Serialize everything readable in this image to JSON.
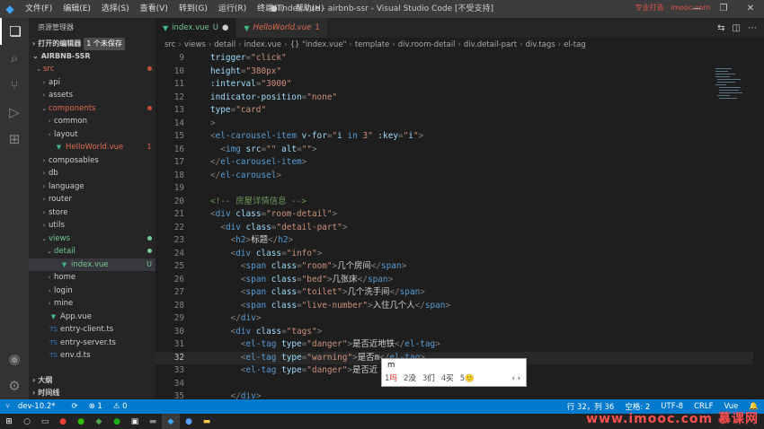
{
  "menu": [
    "文件(F)",
    "编辑(E)",
    "选择(S)",
    "查看(V)",
    "转到(G)",
    "运行(R)",
    "终端(T)",
    "帮助(H)"
  ],
  "window_title": "● index.vue - airbnb-ssr - Visual Studio Code [不受支持]",
  "watermark_top": "专业打造 · imooc.com",
  "sidebar": {
    "title": "资源管理器",
    "open_editors": "打开的编辑器",
    "unsaved_badge": "1 个未保存",
    "project": "AIRBNB-SSR",
    "items": [
      {
        "name": "src",
        "indent": 1,
        "chev": "⌄",
        "color": "#e06c4f",
        "status": "dot-red",
        "sel": false
      },
      {
        "name": "api",
        "indent": 2,
        "chev": "›",
        "color": "#ccc",
        "status": "",
        "sel": false
      },
      {
        "name": "assets",
        "indent": 2,
        "chev": "›",
        "color": "#ccc",
        "status": "",
        "sel": false
      },
      {
        "name": "components",
        "indent": 2,
        "chev": "⌄",
        "color": "#e06c4f",
        "status": "dot-red",
        "sel": false
      },
      {
        "name": "common",
        "indent": 3,
        "chev": "›",
        "color": "#ccc",
        "status": "",
        "sel": false
      },
      {
        "name": "layout",
        "indent": 3,
        "chev": "›",
        "color": "#ccc",
        "status": "",
        "sel": false
      },
      {
        "name": "HelloWorld.vue",
        "indent": 3,
        "chev": "",
        "color": "#e06c4f",
        "status": "1",
        "sel": false,
        "icon": "vue"
      },
      {
        "name": "composables",
        "indent": 2,
        "chev": "›",
        "color": "#ccc",
        "status": "",
        "sel": false
      },
      {
        "name": "db",
        "indent": 2,
        "chev": "›",
        "color": "#ccc",
        "status": "",
        "sel": false
      },
      {
        "name": "language",
        "indent": 2,
        "chev": "›",
        "color": "#ccc",
        "status": "",
        "sel": false
      },
      {
        "name": "router",
        "indent": 2,
        "chev": "›",
        "color": "#ccc",
        "status": "",
        "sel": false
      },
      {
        "name": "store",
        "indent": 2,
        "chev": "›",
        "color": "#ccc",
        "status": "",
        "sel": false
      },
      {
        "name": "utils",
        "indent": 2,
        "chev": "›",
        "color": "#ccc",
        "status": "",
        "sel": false
      },
      {
        "name": "views",
        "indent": 2,
        "chev": "⌄",
        "color": "#73c991",
        "status": "dot-green",
        "sel": false
      },
      {
        "name": "detail",
        "indent": 3,
        "chev": "⌄",
        "color": "#73c991",
        "status": "dot-green",
        "sel": false
      },
      {
        "name": "index.vue",
        "indent": 4,
        "chev": "",
        "color": "#73c991",
        "status": "U",
        "sel": true,
        "icon": "vue"
      },
      {
        "name": "home",
        "indent": 3,
        "chev": "›",
        "color": "#ccc",
        "status": "",
        "sel": false
      },
      {
        "name": "login",
        "indent": 3,
        "chev": "›",
        "color": "#ccc",
        "status": "",
        "sel": false
      },
      {
        "name": "mine",
        "indent": 3,
        "chev": "›",
        "color": "#ccc",
        "status": "",
        "sel": false
      },
      {
        "name": "App.vue",
        "indent": 2,
        "chev": "",
        "color": "#ccc",
        "status": "",
        "sel": false,
        "icon": "vue"
      },
      {
        "name": "entry-client.ts",
        "indent": 2,
        "chev": "",
        "color": "#ccc",
        "status": "",
        "sel": false,
        "icon": "ts"
      },
      {
        "name": "entry-server.ts",
        "indent": 2,
        "chev": "",
        "color": "#ccc",
        "status": "",
        "sel": false,
        "icon": "ts"
      },
      {
        "name": "env.d.ts",
        "indent": 2,
        "chev": "",
        "color": "#ccc",
        "status": "",
        "sel": false,
        "icon": "ts"
      }
    ],
    "outline": "大纲",
    "timeline": "时间线"
  },
  "tabs": [
    {
      "label": "index.vue",
      "suffix": "U",
      "active": true,
      "modified": true
    },
    {
      "label": "HelloWorld.vue",
      "suffix": "1",
      "active": false,
      "modified": false
    }
  ],
  "breadcrumbs": [
    "src",
    "views",
    "detail",
    "index.vue",
    "{} \"index.vue\"",
    "template",
    "div.room-detail",
    "div.detail-part",
    "div.tags",
    "el-tag"
  ],
  "code_lines": [
    {
      "n": "9",
      "t": [
        [
          "t-attr",
          "trigger"
        ],
        [
          "t-pun",
          "="
        ],
        [
          "t-str",
          "\"click\""
        ]
      ]
    },
    {
      "n": "10",
      "t": [
        [
          "t-attr",
          "height"
        ],
        [
          "t-pun",
          "="
        ],
        [
          "t-str",
          "\"380px\""
        ]
      ]
    },
    {
      "n": "11",
      "t": [
        [
          "t-attr",
          ":interval"
        ],
        [
          "t-pun",
          "="
        ],
        [
          "t-str",
          "\"3000\""
        ]
      ]
    },
    {
      "n": "12",
      "t": [
        [
          "t-attr",
          "indicator-position"
        ],
        [
          "t-pun",
          "="
        ],
        [
          "t-str",
          "\"none\""
        ]
      ]
    },
    {
      "n": "13",
      "t": [
        [
          "t-attr",
          "type"
        ],
        [
          "t-pun",
          "="
        ],
        [
          "t-str",
          "\"card\""
        ]
      ]
    },
    {
      "n": "14",
      "t": [
        [
          "t-pun",
          ">"
        ]
      ]
    },
    {
      "n": "15",
      "t": [
        [
          "t-pun",
          "<"
        ],
        [
          "t-tag",
          "el-carousel-item"
        ],
        [
          "t-txt",
          " "
        ],
        [
          "t-attr",
          "v-for"
        ],
        [
          "t-pun",
          "="
        ],
        [
          "t-str",
          "\""
        ],
        [
          "t-attr",
          "i"
        ],
        [
          "t-txt",
          " "
        ],
        [
          "t-tag",
          "in"
        ],
        [
          "t-txt",
          " "
        ],
        [
          "t-str",
          "3"
        ],
        [
          "t-str",
          "\""
        ],
        [
          "t-txt",
          " "
        ],
        [
          "t-attr",
          ":key"
        ],
        [
          "t-pun",
          "="
        ],
        [
          "t-str",
          "\""
        ],
        [
          "t-attr",
          "i"
        ],
        [
          "t-str",
          "\""
        ],
        [
          "t-pun",
          ">"
        ]
      ]
    },
    {
      "n": "16",
      "t": [
        [
          "t-txt",
          "  "
        ],
        [
          "t-pun",
          "<"
        ],
        [
          "t-tag",
          "img"
        ],
        [
          "t-txt",
          " "
        ],
        [
          "t-attr",
          "src"
        ],
        [
          "t-pun",
          "="
        ],
        [
          "t-str",
          "\"\""
        ],
        [
          "t-txt",
          " "
        ],
        [
          "t-attr",
          "alt"
        ],
        [
          "t-pun",
          "="
        ],
        [
          "t-str",
          "\"\""
        ],
        [
          "t-pun",
          ">"
        ]
      ]
    },
    {
      "n": "17",
      "t": [
        [
          "t-pun",
          "</"
        ],
        [
          "t-tag",
          "el-carousel-item"
        ],
        [
          "t-pun",
          ">"
        ]
      ]
    },
    {
      "n": "18",
      "t": [
        [
          "t-pun",
          "</"
        ],
        [
          "t-tag",
          "el-carousel"
        ],
        [
          "t-pun",
          ">"
        ]
      ]
    },
    {
      "n": "19",
      "t": []
    },
    {
      "n": "20",
      "t": [
        [
          "t-com",
          "<!-- 房屋详情信息 -->"
        ]
      ]
    },
    {
      "n": "21",
      "t": [
        [
          "t-pun",
          "<"
        ],
        [
          "t-tag",
          "div"
        ],
        [
          "t-txt",
          " "
        ],
        [
          "t-attr",
          "class"
        ],
        [
          "t-pun",
          "="
        ],
        [
          "t-str",
          "\"room-detail\""
        ],
        [
          "t-pun",
          ">"
        ]
      ]
    },
    {
      "n": "22",
      "t": [
        [
          "t-txt",
          "  "
        ],
        [
          "t-pun",
          "<"
        ],
        [
          "t-tag",
          "div"
        ],
        [
          "t-txt",
          " "
        ],
        [
          "t-attr",
          "class"
        ],
        [
          "t-pun",
          "="
        ],
        [
          "t-str",
          "\"detail-part\""
        ],
        [
          "t-pun",
          ">"
        ]
      ]
    },
    {
      "n": "23",
      "t": [
        [
          "t-txt",
          "    "
        ],
        [
          "t-pun",
          "<"
        ],
        [
          "t-tag",
          "h2"
        ],
        [
          "t-pun",
          ">"
        ],
        [
          "t-txt",
          "标题"
        ],
        [
          "t-pun",
          "</"
        ],
        [
          "t-tag",
          "h2"
        ],
        [
          "t-pun",
          ">"
        ]
      ]
    },
    {
      "n": "24",
      "t": [
        [
          "t-txt",
          "    "
        ],
        [
          "t-pun",
          "<"
        ],
        [
          "t-tag",
          "div"
        ],
        [
          "t-txt",
          " "
        ],
        [
          "t-attr",
          "class"
        ],
        [
          "t-pun",
          "="
        ],
        [
          "t-str",
          "\"info\""
        ],
        [
          "t-pun",
          ">"
        ]
      ]
    },
    {
      "n": "25",
      "t": [
        [
          "t-txt",
          "      "
        ],
        [
          "t-pun",
          "<"
        ],
        [
          "t-tag",
          "span"
        ],
        [
          "t-txt",
          " "
        ],
        [
          "t-attr",
          "class"
        ],
        [
          "t-pun",
          "="
        ],
        [
          "t-str",
          "\"room\""
        ],
        [
          "t-pun",
          ">"
        ],
        [
          "t-txt",
          "几个房间"
        ],
        [
          "t-pun",
          "</"
        ],
        [
          "t-tag",
          "span"
        ],
        [
          "t-pun",
          ">"
        ]
      ]
    },
    {
      "n": "26",
      "t": [
        [
          "t-txt",
          "      "
        ],
        [
          "t-pun",
          "<"
        ],
        [
          "t-tag",
          "span"
        ],
        [
          "t-txt",
          " "
        ],
        [
          "t-attr",
          "class"
        ],
        [
          "t-pun",
          "="
        ],
        [
          "t-str",
          "\"bed\""
        ],
        [
          "t-pun",
          ">"
        ],
        [
          "t-txt",
          "几张床"
        ],
        [
          "t-pun",
          "</"
        ],
        [
          "t-tag",
          "span"
        ],
        [
          "t-pun",
          ">"
        ]
      ]
    },
    {
      "n": "27",
      "t": [
        [
          "t-txt",
          "      "
        ],
        [
          "t-pun",
          "<"
        ],
        [
          "t-tag",
          "span"
        ],
        [
          "t-txt",
          " "
        ],
        [
          "t-attr",
          "class"
        ],
        [
          "t-pun",
          "="
        ],
        [
          "t-str",
          "\"toilet\""
        ],
        [
          "t-pun",
          ">"
        ],
        [
          "t-txt",
          "几个洗手间"
        ],
        [
          "t-pun",
          "</"
        ],
        [
          "t-tag",
          "span"
        ],
        [
          "t-pun",
          ">"
        ]
      ]
    },
    {
      "n": "28",
      "t": [
        [
          "t-txt",
          "      "
        ],
        [
          "t-pun",
          "<"
        ],
        [
          "t-tag",
          "span"
        ],
        [
          "t-txt",
          " "
        ],
        [
          "t-attr",
          "class"
        ],
        [
          "t-pun",
          "="
        ],
        [
          "t-str",
          "\"live-number\""
        ],
        [
          "t-pun",
          ">"
        ],
        [
          "t-txt",
          "入住几个人"
        ],
        [
          "t-pun",
          "</"
        ],
        [
          "t-tag",
          "span"
        ],
        [
          "t-pun",
          ">"
        ]
      ]
    },
    {
      "n": "29",
      "t": [
        [
          "t-txt",
          "    "
        ],
        [
          "t-pun",
          "</"
        ],
        [
          "t-tag",
          "div"
        ],
        [
          "t-pun",
          ">"
        ]
      ]
    },
    {
      "n": "30",
      "t": [
        [
          "t-txt",
          "    "
        ],
        [
          "t-pun",
          "<"
        ],
        [
          "t-tag",
          "div"
        ],
        [
          "t-txt",
          " "
        ],
        [
          "t-attr",
          "class"
        ],
        [
          "t-pun",
          "="
        ],
        [
          "t-str",
          "\"tags\""
        ],
        [
          "t-pun",
          ">"
        ]
      ]
    },
    {
      "n": "31",
      "t": [
        [
          "t-txt",
          "      "
        ],
        [
          "t-pun",
          "<"
        ],
        [
          "t-tag",
          "el-tag"
        ],
        [
          "t-txt",
          " "
        ],
        [
          "t-attr",
          "type"
        ],
        [
          "t-pun",
          "="
        ],
        [
          "t-str",
          "\"danger\""
        ],
        [
          "t-pun",
          ">"
        ],
        [
          "t-txt",
          "是否近地铁"
        ],
        [
          "t-pun",
          "</"
        ],
        [
          "t-tag",
          "el-tag"
        ],
        [
          "t-pun",
          ">"
        ]
      ]
    },
    {
      "n": "32",
      "t": [
        [
          "t-txt",
          "      "
        ],
        [
          "t-pun",
          "<"
        ],
        [
          "t-tag",
          "el-tag"
        ],
        [
          "t-txt",
          " "
        ],
        [
          "t-attr",
          "type"
        ],
        [
          "t-pun",
          "="
        ],
        [
          "t-str",
          "\"warning\""
        ],
        [
          "t-pun",
          ">"
        ],
        [
          "t-txt",
          "是否m"
        ],
        [
          "t-pun",
          "</"
        ],
        [
          "t-tag",
          "el-tag"
        ],
        [
          "t-pun",
          ">"
        ]
      ],
      "cur": true
    },
    {
      "n": "33",
      "t": [
        [
          "t-txt",
          "      "
        ],
        [
          "t-pun",
          "<"
        ],
        [
          "t-tag",
          "el-tag"
        ],
        [
          "t-txt",
          " "
        ],
        [
          "t-attr",
          "type"
        ],
        [
          "t-pun",
          "="
        ],
        [
          "t-str",
          "\"danger\""
        ],
        [
          "t-pun",
          ">"
        ],
        [
          "t-txt",
          "是否近"
        ]
      ]
    },
    {
      "n": "34",
      "t": []
    },
    {
      "n": "35",
      "t": [
        [
          "t-txt",
          "    "
        ],
        [
          "t-pun",
          "</"
        ],
        [
          "t-tag",
          "div"
        ],
        [
          "t-pun",
          ">"
        ]
      ]
    }
  ],
  "ime": {
    "input": "m",
    "candidates": [
      {
        "i": "1",
        "w": "吗",
        "hl": true
      },
      {
        "i": "2",
        "w": "没",
        "hl": false
      },
      {
        "i": "3",
        "w": "们",
        "hl": false
      },
      {
        "i": "4",
        "w": "买",
        "hl": false
      },
      {
        "i": "5",
        "w": "🙂",
        "hl": false
      }
    ],
    "nav": "‹ ›"
  },
  "status": {
    "branch": "dev-10.2*",
    "sync": "⟳",
    "errors": "⊗ 1",
    "warnings": "⚠ 0",
    "position": "行 32，列 36",
    "spaces": "空格: 2",
    "encoding": "UTF-8",
    "eol": "CRLF",
    "lang": "Vue"
  },
  "watermark": "www.imooc.com  慕课网",
  "colors": {
    "accent": "#007acc",
    "vue": "#41b883"
  }
}
